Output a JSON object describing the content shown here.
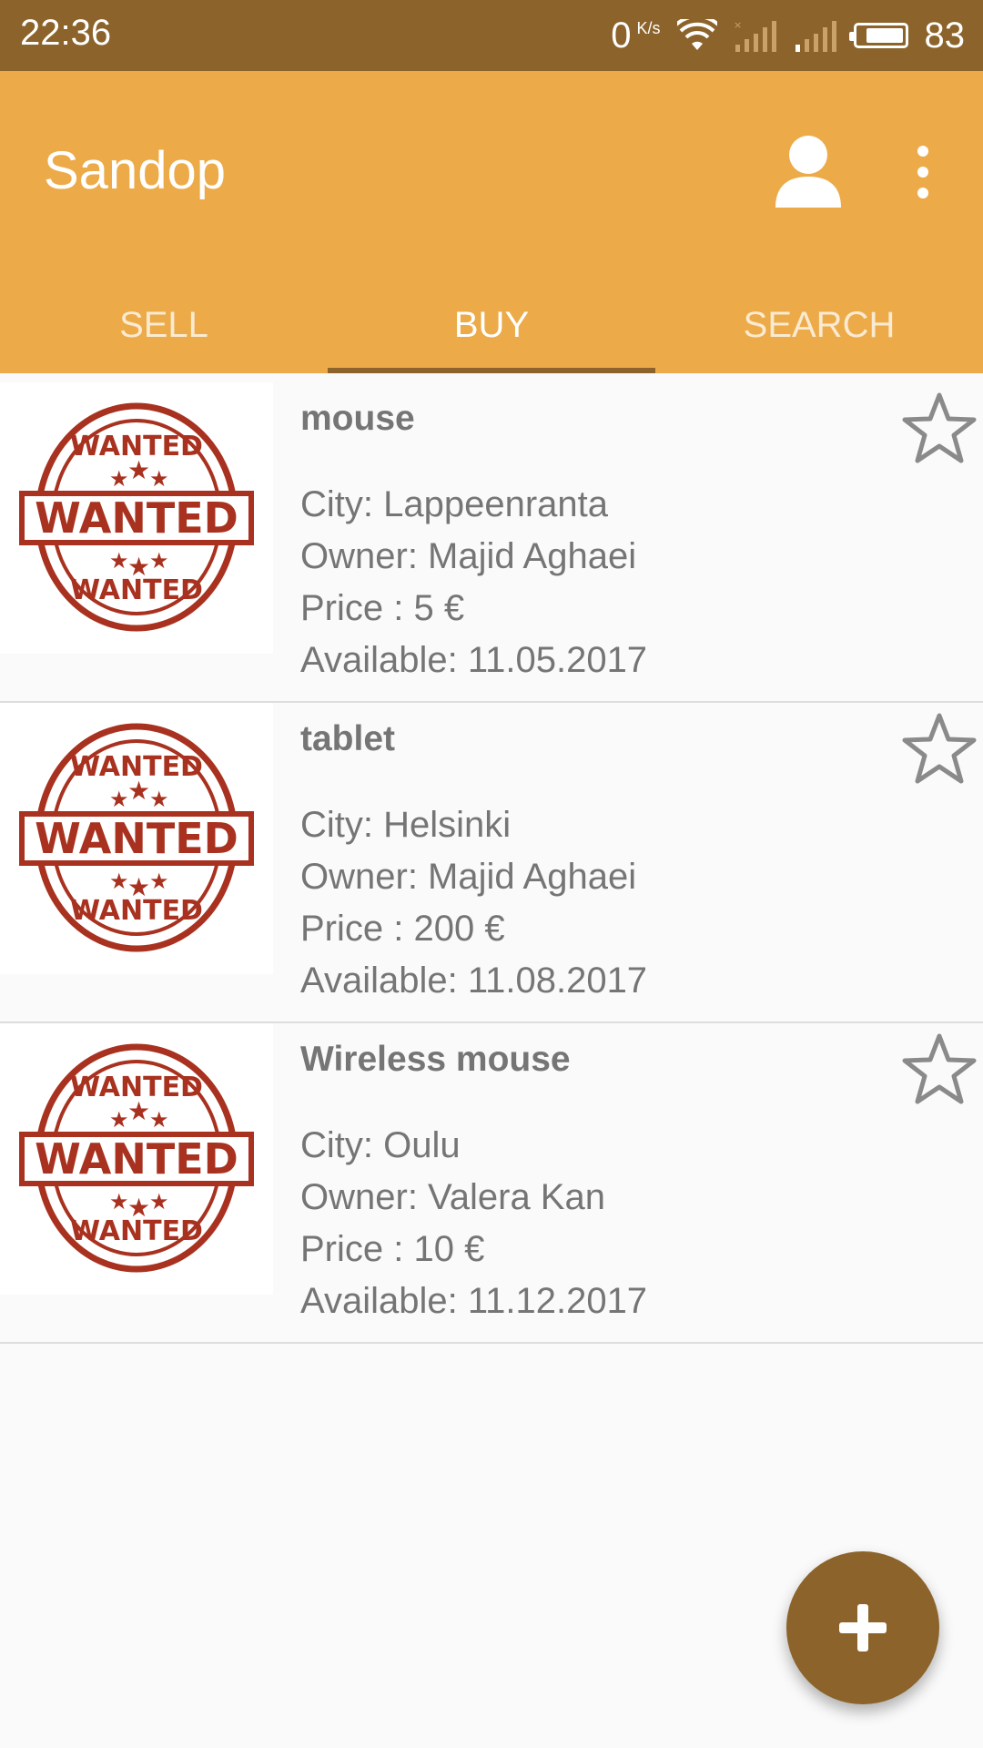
{
  "status_bar": {
    "time": "22:36",
    "speed_value": "0",
    "speed_unit": "K/s",
    "battery": "83",
    "battery_level": 0.83
  },
  "app": {
    "title": "Sandop",
    "brand_color": "#ecab48",
    "accent_color": "#8c632a"
  },
  "tabs": [
    {
      "label": "SELL",
      "active": false
    },
    {
      "label": "BUY",
      "active": true
    },
    {
      "label": "SEARCH",
      "active": false
    }
  ],
  "items": [
    {
      "name": "mouse",
      "city": "City: Lappeenranta",
      "owner": "Owner: Majid Aghaei",
      "price": "Price : 5 €",
      "available": "Available: 11.05.2017",
      "stamp_text": "WANTED"
    },
    {
      "name": "tablet",
      "city": "City: Helsinki",
      "owner": "Owner: Majid Aghaei",
      "price": "Price : 200 €",
      "available": "Available: 11.08.2017",
      "stamp_text": "WANTED"
    },
    {
      "name": "Wireless mouse",
      "city": "City: Oulu",
      "owner": "Owner: Valera Kan",
      "price": "Price : 10 €",
      "available": "Available: 11.12.2017",
      "stamp_text": "WANTED"
    }
  ],
  "icons": {
    "profile": "person-icon",
    "more": "more-vert-icon",
    "favorite": "star-outline-icon",
    "add": "plus-icon"
  }
}
